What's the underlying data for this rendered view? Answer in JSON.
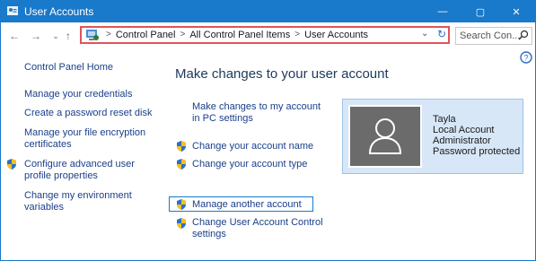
{
  "window": {
    "title": "User Accounts",
    "controls": {
      "minimize": "—",
      "maximize": "▢",
      "close": "✕"
    }
  },
  "address_bar": {
    "crumbs": [
      "Control Panel",
      "All Control Panel Items",
      "User Accounts"
    ],
    "separator": ">"
  },
  "search": {
    "placeholder": "Search Con..."
  },
  "sidebar": {
    "items": [
      {
        "label": "Control Panel Home"
      },
      {
        "label": "Manage your credentials"
      },
      {
        "label": "Create a password reset disk"
      },
      {
        "label_line1": "Manage your file encryption",
        "label_line2": "certificates"
      },
      {
        "label_line1": "Configure advanced user",
        "label_line2": "profile properties"
      },
      {
        "label_line1": "Change my environment",
        "label_line2": "variables"
      }
    ]
  },
  "main": {
    "heading": "Make changes to your user account",
    "pc_settings_line1": "Make changes to my account",
    "pc_settings_line2": "in PC settings",
    "links": {
      "change_name": "Change your account name",
      "change_type": "Change your account type",
      "manage_other": "Manage another account",
      "uac_line1": "Change User Account Control",
      "uac_line2": "settings"
    }
  },
  "account": {
    "name": "Tayla",
    "type": "Local Account",
    "role": "Administrator",
    "protection": "Password protected"
  },
  "colors": {
    "accent": "#1979ca",
    "link": "#1a3f8a",
    "heading": "#1e395b",
    "panel": "#d7e7f7"
  }
}
